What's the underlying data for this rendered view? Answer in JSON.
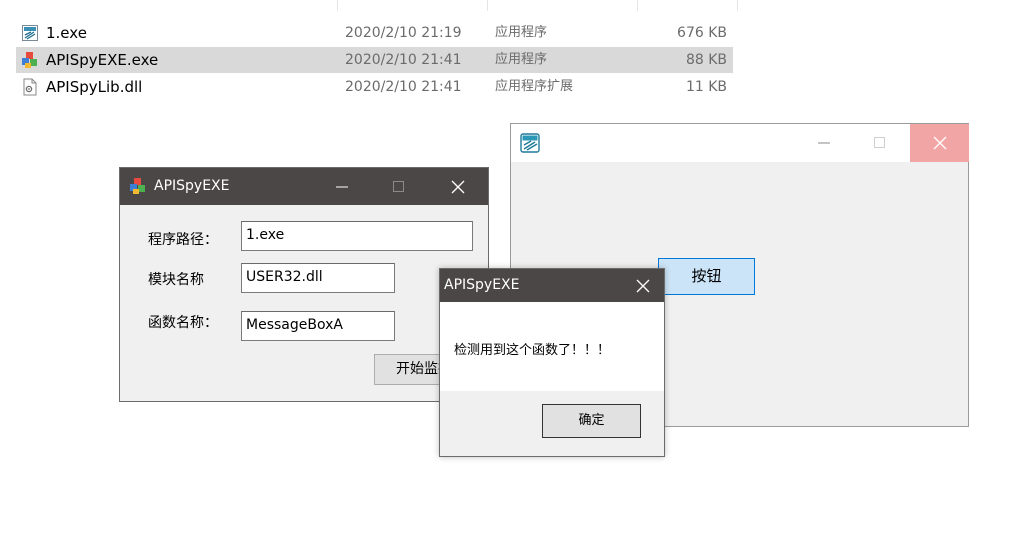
{
  "explorer": {
    "files": [
      {
        "name": "1.exe",
        "date": "2020/2/10 21:19",
        "type": "应用程序",
        "size": "676 KB",
        "icon": "generic-exe-icon",
        "selected": false
      },
      {
        "name": "APISpyEXE.exe",
        "date": "2020/2/10 21:41",
        "type": "应用程序",
        "size": "88 KB",
        "icon": "app-blocks-icon",
        "selected": true
      },
      {
        "name": "APISpyLib.dll",
        "date": "2020/2/10 21:41",
        "type": "应用程序扩展",
        "size": "11 KB",
        "icon": "dll-file-icon",
        "selected": false
      }
    ]
  },
  "main_window": {
    "title": "APISpyEXE",
    "path_label": "程序路径：",
    "path_value": "1.exe",
    "module_label": "模块名称",
    "module_value": "USER32.dll",
    "func_label": "函数名称：",
    "func_value": "MessageBoxA",
    "start_button": "开始监控"
  },
  "right_window": {
    "title": "",
    "button": "按钮"
  },
  "message_box": {
    "title": "APISpyEXE",
    "message": "检测用到这个函数了！！！",
    "ok_button": "确定"
  },
  "colors": {
    "titlebar_dark": "#4a4746",
    "close_hover": "#f2a5a5",
    "selection": "#d9d9d9",
    "button_focus": "#cce4f7"
  }
}
